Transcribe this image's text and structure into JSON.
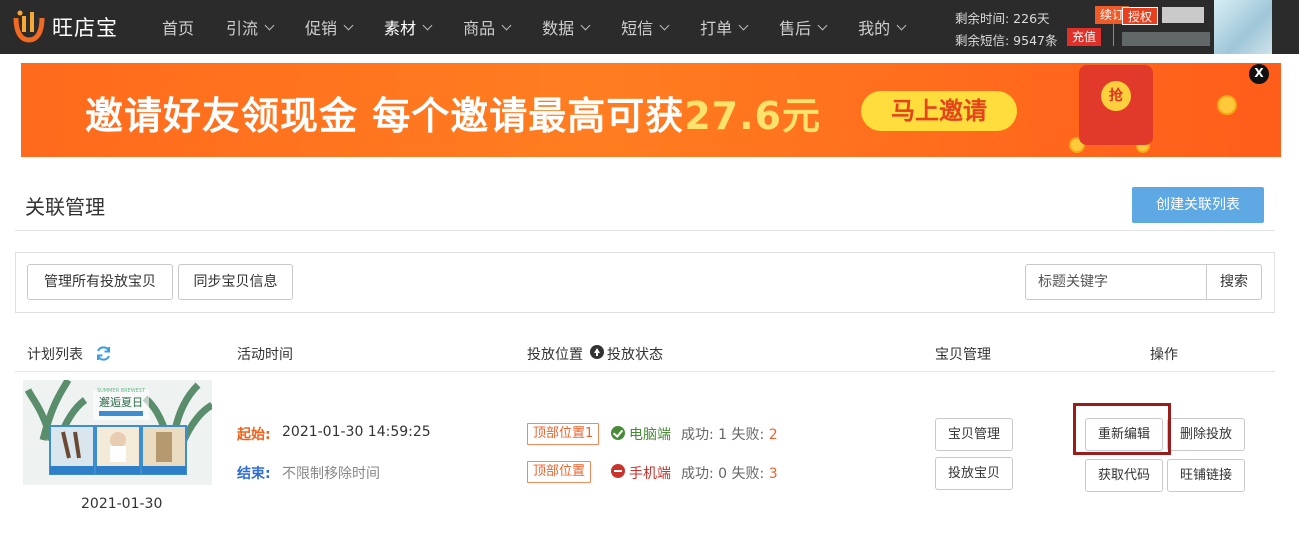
{
  "app": {
    "logo_text": "旺店宝"
  },
  "nav": {
    "items": [
      {
        "label": "首页",
        "has_dropdown": false,
        "active": false
      },
      {
        "label": "引流",
        "has_dropdown": true,
        "active": false
      },
      {
        "label": "促销",
        "has_dropdown": true,
        "active": false
      },
      {
        "label": "素材",
        "has_dropdown": true,
        "active": true
      },
      {
        "label": "商品",
        "has_dropdown": true,
        "active": false
      },
      {
        "label": "数据",
        "has_dropdown": true,
        "active": false
      },
      {
        "label": "短信",
        "has_dropdown": true,
        "active": false
      },
      {
        "label": "打单",
        "has_dropdown": true,
        "active": false
      },
      {
        "label": "售后",
        "has_dropdown": true,
        "active": false
      },
      {
        "label": "我的",
        "has_dropdown": true,
        "active": false
      }
    ],
    "remaining_time": "剩余时间: 226天",
    "remaining_sms": "剩余短信: 9547条",
    "renew_label": "续订",
    "recharge_label": "充值",
    "auth_label": "授权"
  },
  "banner": {
    "text_main": "邀请好友领现金 每个邀请最高可获",
    "text_amount": "27.6元",
    "button_label": "马上邀请",
    "envelope_label": "抢",
    "close_label": "X",
    "color_bg": "#ff6a1c",
    "color_highlight": "#ffe26b"
  },
  "page": {
    "title": "关联管理",
    "create_button": "创建关联列表"
  },
  "toolbar": {
    "manage_all_label": "管理所有投放宝贝",
    "sync_label": "同步宝贝信息",
    "search_placeholder": "标题关键字",
    "search_button": "搜索"
  },
  "table": {
    "headers": {
      "plan_list": "计划列表",
      "activity_time": "活动时间",
      "position": "投放位置",
      "status": "投放状态",
      "item_manage": "宝贝管理",
      "actions": "操作"
    },
    "rows": [
      {
        "thumbnail_text": "邂逅夏日",
        "thumbnail_subtitle": "SUMMER BREWEST",
        "date": "2021-01-30",
        "start_label": "起始:",
        "start_value": "2021-01-30 14:59:25",
        "end_label": "结束:",
        "end_value": "不限制移除时间",
        "placements": [
          {
            "position": "顶部位置1",
            "platform": "电脑端",
            "success_label": "成功:",
            "success": "1",
            "fail_label": "失败:",
            "fail": "2",
            "status": "ok"
          },
          {
            "position": "顶部位置",
            "platform": "手机端",
            "success_label": "成功:",
            "success": "0",
            "fail_label": "失败:",
            "fail": "3",
            "status": "blocked"
          }
        ],
        "item_buttons": [
          "宝贝管理",
          "投放宝贝"
        ],
        "action_buttons": [
          "重新编辑",
          "删除投放",
          "获取代码",
          "旺铺链接"
        ]
      }
    ]
  },
  "colors": {
    "topbar": "#2b2b2b",
    "primary_button": "#5ea9e3",
    "start_label": "#f0621b",
    "end_label": "#2e6dd6",
    "ok": "#4a8b3a",
    "blocked": "#c8332c",
    "highlight": "#9b1c1c"
  }
}
